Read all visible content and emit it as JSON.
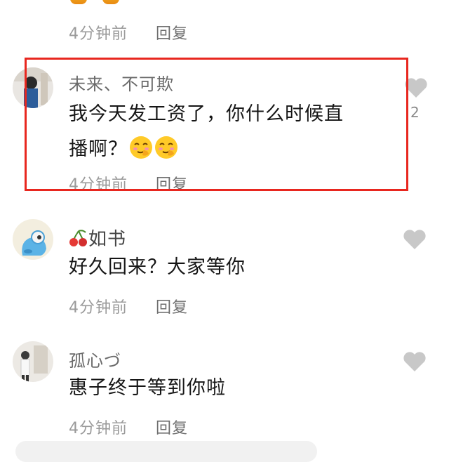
{
  "colors": {
    "highlight": "#e8271f",
    "meta": "#9a9a9a",
    "username": "#6a6a6a",
    "text": "#161616",
    "heart": "#c8c8c8"
  },
  "comments": [
    {
      "meta": {
        "time": "4分钟前",
        "reply": "回复"
      }
    },
    {
      "username": "未来、不可欺",
      "lines": [
        "我今天发工资了，你什么时候直",
        "播啊？"
      ],
      "emojis": [
        "smirk-face-icon",
        "smirk-face-icon"
      ],
      "like_count": "2",
      "meta": {
        "time": "4分钟前",
        "reply": "回复"
      },
      "highlighted": true
    },
    {
      "username_prefix_icon": "cherry-icon",
      "username": "如书",
      "lines": [
        "好久回来？大家等你"
      ],
      "meta": {
        "time": "4分钟前",
        "reply": "回复"
      }
    },
    {
      "username": "孤心づ",
      "lines": [
        "惠子终于等到你啦"
      ],
      "meta": {
        "time": "4分钟前",
        "reply": "回复"
      }
    }
  ]
}
